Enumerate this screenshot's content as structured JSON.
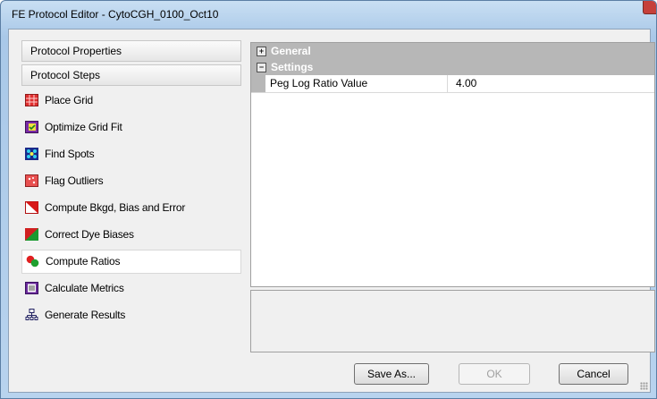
{
  "window": {
    "title": "FE Protocol Editor - CytoCGH_0100_Oct10"
  },
  "left_pane": {
    "headers": [
      "Protocol Properties",
      "Protocol Steps"
    ],
    "steps": [
      {
        "label": "Place Grid",
        "icon": "place-grid-icon",
        "selected": false
      },
      {
        "label": "Optimize Grid Fit",
        "icon": "optimize-grid-icon",
        "selected": false
      },
      {
        "label": "Find Spots",
        "icon": "find-spots-icon",
        "selected": false
      },
      {
        "label": "Flag Outliers",
        "icon": "flag-outliers-icon",
        "selected": false
      },
      {
        "label": "Compute Bkgd, Bias and Error",
        "icon": "compute-bkgd-icon",
        "selected": false
      },
      {
        "label": "Correct Dye Biases",
        "icon": "correct-dye-icon",
        "selected": false
      },
      {
        "label": "Compute Ratios",
        "icon": "compute-ratios-icon",
        "selected": true
      },
      {
        "label": "Calculate Metrics",
        "icon": "calculate-metrics-icon",
        "selected": false
      },
      {
        "label": "Generate Results",
        "icon": "generate-results-icon",
        "selected": false
      }
    ]
  },
  "property_grid": {
    "categories": [
      {
        "name": "General",
        "expanded": false,
        "toggle": "+"
      },
      {
        "name": "Settings",
        "expanded": true,
        "toggle": "−"
      }
    ],
    "rows": [
      {
        "name": "Peg Log Ratio Value",
        "value": "4.00"
      }
    ]
  },
  "buttons": {
    "save_as": "Save As...",
    "ok": "OK",
    "cancel": "Cancel"
  }
}
